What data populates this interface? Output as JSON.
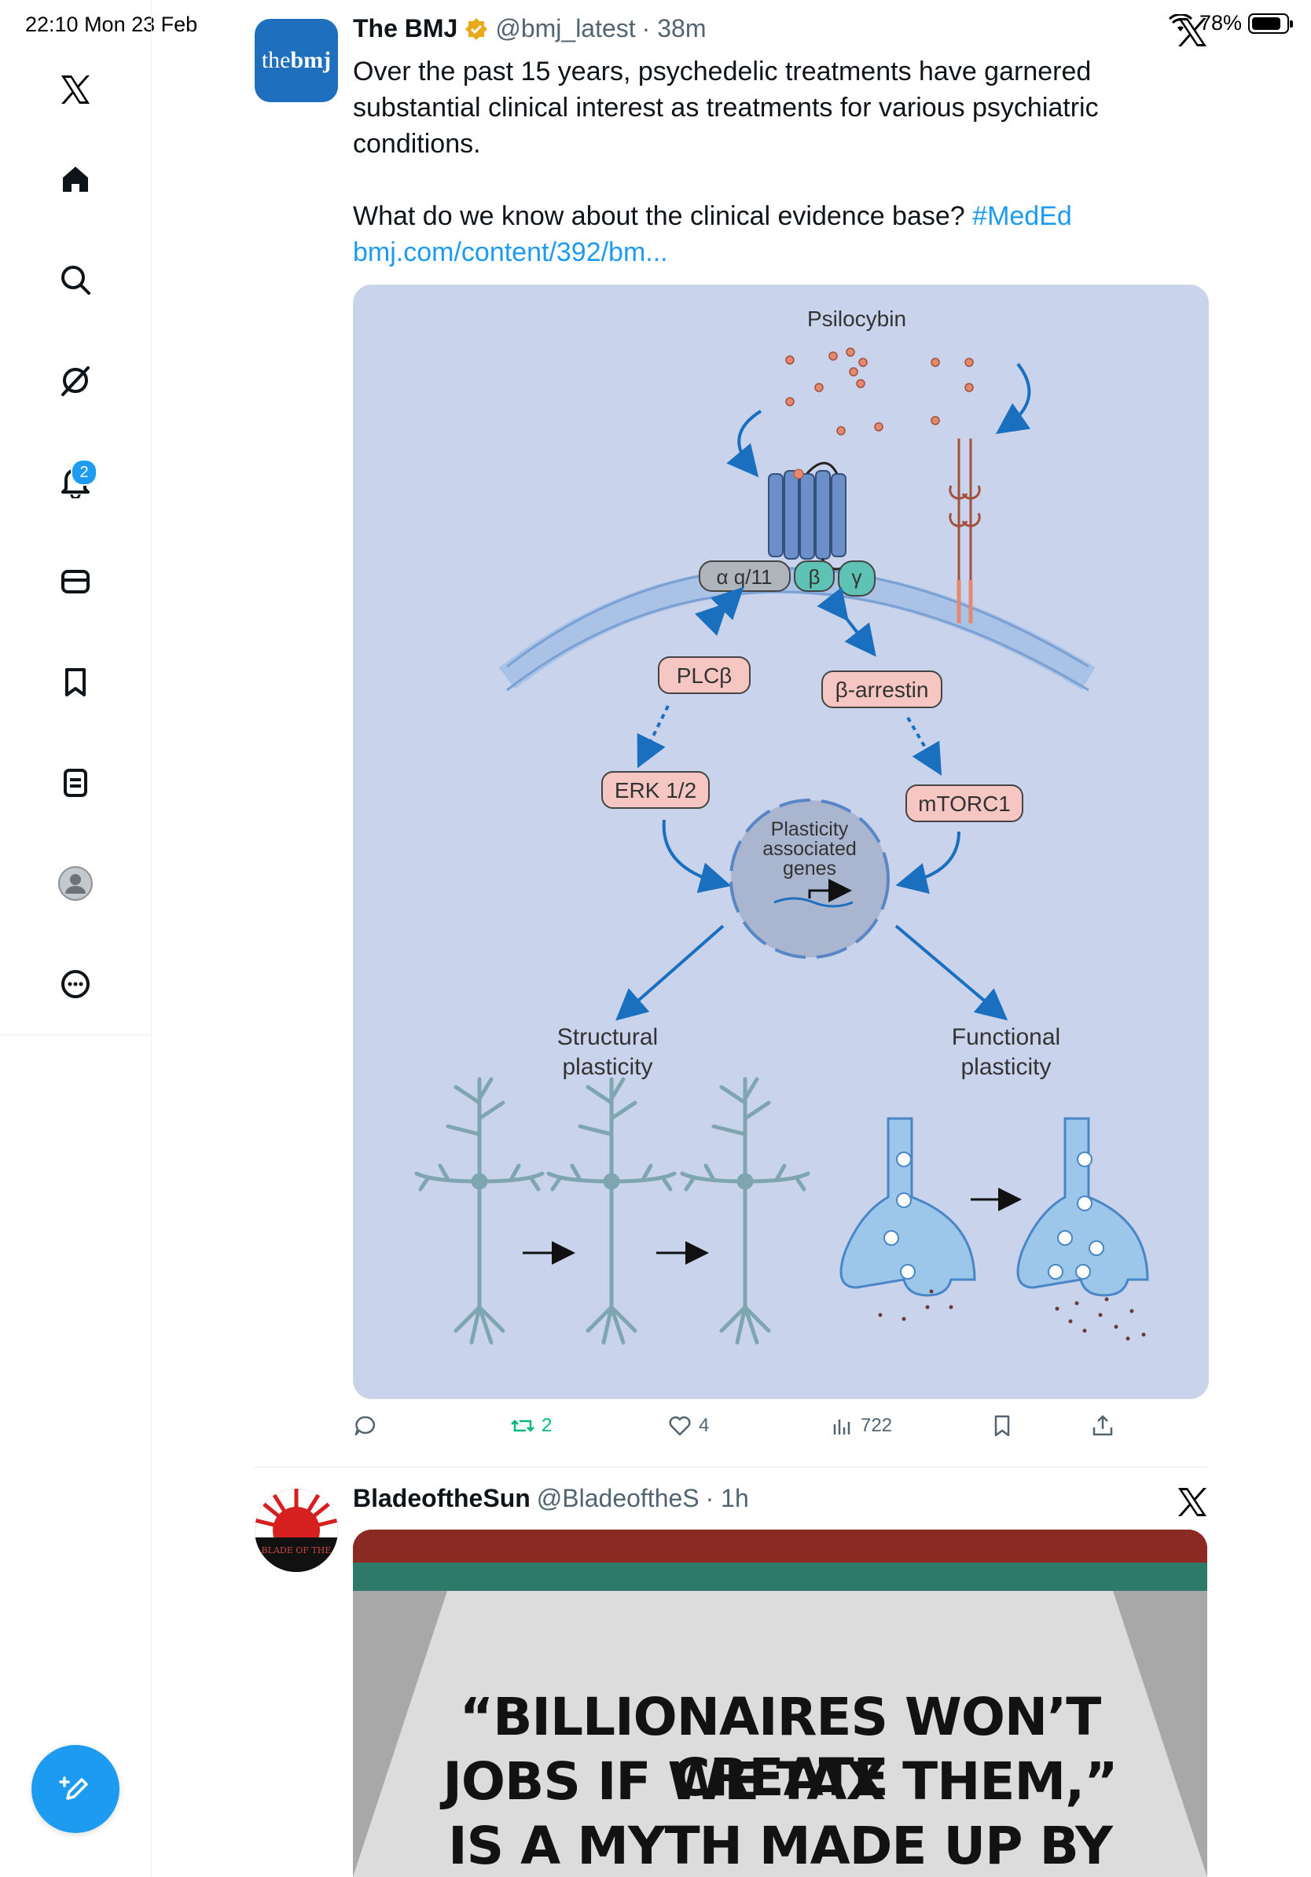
{
  "status_bar": {
    "time_date": "22:10  Mon 23 Feb",
    "battery": "78%"
  },
  "sidebar": {
    "items": [
      {
        "name": "x-logo"
      },
      {
        "name": "home"
      },
      {
        "name": "explore"
      },
      {
        "name": "grok"
      },
      {
        "name": "notifications"
      },
      {
        "name": "messages"
      },
      {
        "name": "bookmarks"
      },
      {
        "name": "lists"
      },
      {
        "name": "profile"
      },
      {
        "name": "more"
      }
    ],
    "notifications_badge": "2"
  },
  "tweets": [
    {
      "avatar_text": "thebmj",
      "name": "The BMJ",
      "handle": "@bmj_latest",
      "time": "· 38m",
      "text_1": "Over the past 15 years, psychedelic treatments have garnered substantial clinical interest as treatments for various psychiatric conditions.",
      "text_2": "What do we know about the clinical evidence base?",
      "hashtag": "#MedEd",
      "link": "bmj.com/content/392/bm...",
      "figure": {
        "title": "Psilocybin",
        "subunit_alpha": "α q/11",
        "subunit_beta": "β",
        "subunit_gamma": "γ",
        "plcb": "PLCβ",
        "barrestin": "β-arrestin",
        "erk": "ERK 1/2",
        "mtorc": "mTORC1",
        "nucleus_1": "Plasticity",
        "nucleus_2": "associated",
        "nucleus_3": "genes",
        "structural_1": "Structural",
        "structural_2": "plasticity",
        "functional_1": "Functional",
        "functional_2": "plasticity"
      },
      "stats": {
        "reposts": "2",
        "likes": "4",
        "views": "722"
      }
    },
    {
      "name": "BladeoftheSun",
      "handle": "@BladeoftheS",
      "time": "· 1h",
      "avatar_text": "BLADE OF THE",
      "meme_line_1": "“BILLIONAIRES WON’T CREATE",
      "meme_line_2": "JOBS IF WE TAX THEM,”",
      "meme_line_3": "IS A MYTH MADE UP BY"
    }
  ],
  "colors": {
    "accent": "#1d9bf0",
    "repost_green": "#00ba7c",
    "figure_bg": "#c9d3ec"
  }
}
